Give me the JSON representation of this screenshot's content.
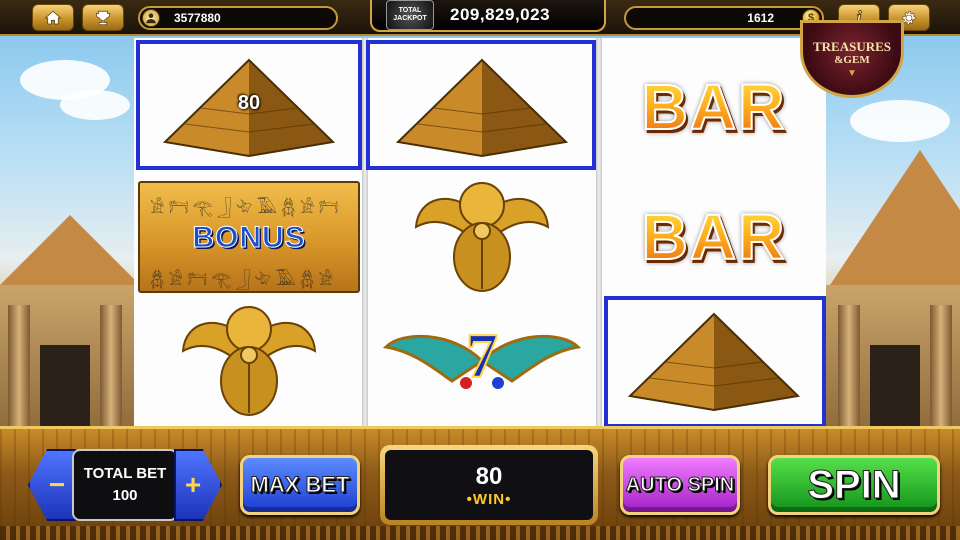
{
  "top_bar": {
    "home_icon": "home-icon",
    "trophy_icon": "trophy-icon",
    "player_id": "3577880",
    "jackpot_badge_line1": "TOTAL",
    "jackpot_badge_line2": "JACKPOT",
    "jackpot_value": "209,829,023",
    "coins": "1612",
    "coin_symbol": "$",
    "info_label": "i",
    "settings_icon": "gear-icon"
  },
  "feature_badge": {
    "line1": "TREASURES",
    "line2": "&GEM"
  },
  "reels": {
    "reel1": [
      {
        "symbol": "pyramid",
        "label": "80"
      },
      {
        "symbol": "bonus",
        "label": "BONUS"
      },
      {
        "symbol": "scarab"
      }
    ],
    "reel2": [
      {
        "symbol": "pyramid"
      },
      {
        "symbol": "scarab"
      },
      {
        "symbol": "winged-seven",
        "label": "7"
      }
    ],
    "reel3": [
      {
        "symbol": "bar",
        "label": "BAR"
      },
      {
        "symbol": "bar",
        "label": "BAR"
      },
      {
        "symbol": "pyramid"
      }
    ],
    "winning_line_color": "#2330d4"
  },
  "controls": {
    "total_bet_label": "TOTAL BET",
    "total_bet_value": "100",
    "decrease_label": "−",
    "increase_label": "+",
    "max_bet_label": "MAX BET",
    "win_value": "80",
    "win_label": "•WIN•",
    "auto_spin_label": "AUTO SPIN",
    "spin_label": "SPIN"
  }
}
